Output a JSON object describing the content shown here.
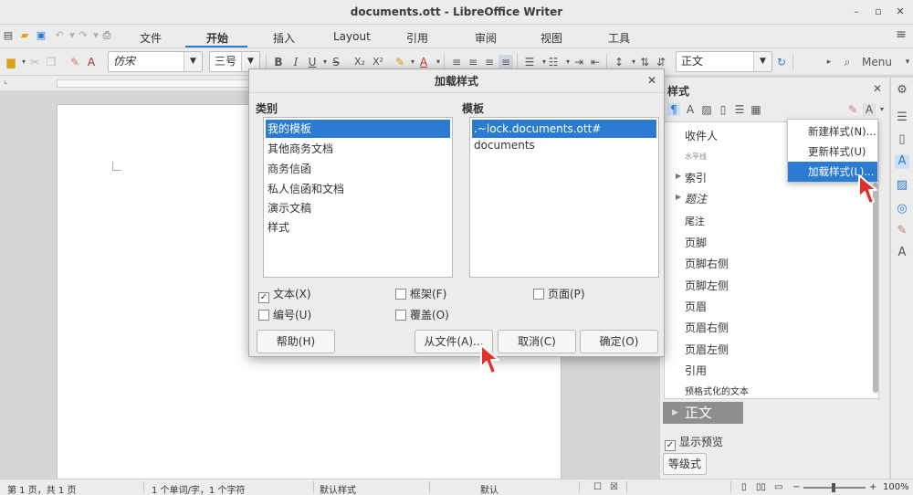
{
  "window": {
    "title": "documents.ott - LibreOffice Writer"
  },
  "tabs": [
    "文件",
    "开始",
    "插入",
    "Layout",
    "引用",
    "审阅",
    "视图",
    "工具"
  ],
  "toolbar": {
    "font_name": "仿宋",
    "font_size": "三号",
    "bold": "B",
    "italic": "I",
    "underline": "U",
    "strike": "S",
    "subscript": "X₂",
    "superscript": "X²",
    "para_style": "正文",
    "menu_label": "Menu"
  },
  "sidebar": {
    "title": "样式",
    "styles": [
      "收件人",
      "水平线",
      "索引",
      "题注",
      "尾注",
      "页脚",
      "页脚右侧",
      "页脚左侧",
      "页眉",
      "页眉右侧",
      "页眉左侧",
      "引用",
      "预格式化的文本"
    ],
    "selected_style": "正文",
    "show_preview": "显示预览",
    "level_combo": "等级式"
  },
  "style_menu": {
    "items": [
      "新建样式(N)...",
      "更新样式(U)",
      "加载样式(L)..."
    ]
  },
  "dialog": {
    "title": "加载样式",
    "category_label": "类别",
    "categories": [
      "我的模板",
      "其他商务文档",
      "商务信函",
      "私人信函和文档",
      "演示文稿",
      "样式"
    ],
    "template_label": "模板",
    "templates": [
      ".~lock.documents.ott#",
      "documents"
    ],
    "options": {
      "text": "文本(X)",
      "frame": "框架(F)",
      "page": "页面(P)",
      "numbering": "编号(U)",
      "overwrite": "覆盖(O)"
    },
    "buttons": {
      "help": "帮助(H)",
      "from_file": "从文件(A)...",
      "cancel": "取消(C)",
      "ok": "确定(O)"
    }
  },
  "statusbar": {
    "page": "第 1 页，共 1 页",
    "words": "1 个单词/字，1 个字符",
    "page_style": "默认样式",
    "language": "默认",
    "zoom": "100%"
  },
  "colors": {
    "accent": "#2a7bd1",
    "cursor": "#e0312b"
  }
}
